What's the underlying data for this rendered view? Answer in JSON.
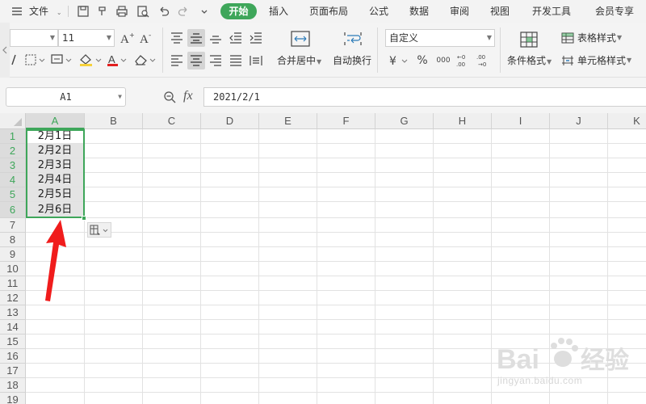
{
  "menubar": {
    "file_label": "文件",
    "tabs": [
      "开始",
      "插入",
      "页面布局",
      "公式",
      "数据",
      "审阅",
      "视图",
      "开发工具",
      "会员专享"
    ],
    "active_tab": "开始"
  },
  "ribbon": {
    "font_name": "",
    "font_size": "11",
    "number_format": "自定义",
    "merge_center_label": "合并居中",
    "wrap_text_label": "自动换行",
    "conditional_format_label": "条件格式",
    "table_style_label": "表格样式",
    "cell_style_label": "单元格样式",
    "percent_symbol": "%",
    "thousands_label": "000"
  },
  "formula_bar": {
    "name_box": "A1",
    "fx_label": "fx",
    "formula": "2021/2/1"
  },
  "sheet": {
    "columns": [
      "A",
      "B",
      "C",
      "D",
      "E",
      "F",
      "G",
      "H",
      "I",
      "J",
      "K"
    ],
    "rows": [
      "1",
      "2",
      "3",
      "4",
      "5",
      "6",
      "7",
      "8",
      "9",
      "10",
      "11",
      "12",
      "13",
      "14",
      "15",
      "16",
      "17",
      "18",
      "19"
    ],
    "cells_a": [
      "2月1日",
      "2月2日",
      "2月3日",
      "2月4日",
      "2月5日",
      "2月6日"
    ]
  },
  "colors": {
    "accent": "#3ea65a",
    "arrow": "#f01c1c"
  },
  "watermark": {
    "brand": "Bai  经验",
    "url": "jingyan.baidu.com"
  }
}
